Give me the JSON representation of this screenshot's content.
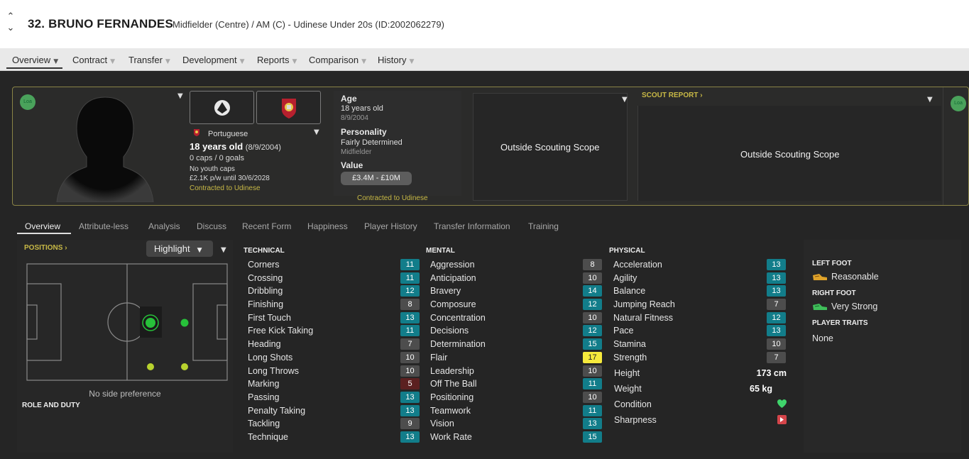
{
  "header": {
    "name": "32. BRUNO FERNANDES",
    "subtitle": "Midfielder (Centre) / AM (C) - Udinese Under 20s (ID:2002062279)"
  },
  "tabs": [
    {
      "label": "Overview",
      "active": true
    },
    {
      "label": "Contract"
    },
    {
      "label": "Transfer"
    },
    {
      "label": "Development"
    },
    {
      "label": "Reports"
    },
    {
      "label": "Comparison"
    },
    {
      "label": "History"
    }
  ],
  "profile": {
    "loan_badge": "Loa",
    "nationality": "Portuguese",
    "age_line": "18 years old",
    "dob_paren": "(8/9/2004)",
    "caps": "0 caps / 0 goals",
    "youth_caps": "No youth caps",
    "wage": "£2.1K p/w until 30/6/2028",
    "contracted": "Contracted to Udinese",
    "age_label": "Age",
    "age_value": "18 years old",
    "dob": "8/9/2004",
    "personality_label": "Personality",
    "personality_value": "Fairly Determined",
    "position_short": "Midfielder",
    "value_label": "Value",
    "value_range": "£3.4M - £10M",
    "contracted2": "Contracted to Udinese",
    "scope1": "Outside Scouting Scope",
    "scout_report": "SCOUT REPORT",
    "scope2": "Outside Scouting Scope"
  },
  "subtabs": [
    "Overview",
    "Attribute-less",
    "Analysis",
    "Discuss",
    "Recent Form",
    "Happiness",
    "Player History",
    "Transfer Information",
    "Training"
  ],
  "positions": {
    "title": "POSITIONS",
    "highlight": "Highlight",
    "no_side": "No side preference",
    "role_duty": "ROLE AND DUTY"
  },
  "technical": {
    "title": "TECHNICAL",
    "rows": [
      {
        "name": "Corners",
        "value": "11",
        "tone": "teal"
      },
      {
        "name": "Crossing",
        "value": "11",
        "tone": "teal"
      },
      {
        "name": "Dribbling",
        "value": "12",
        "tone": "teal"
      },
      {
        "name": "Finishing",
        "value": "8",
        "tone": "grey"
      },
      {
        "name": "First Touch",
        "value": "13",
        "tone": "teal"
      },
      {
        "name": "Free Kick Taking",
        "value": "11",
        "tone": "teal"
      },
      {
        "name": "Heading",
        "value": "7",
        "tone": "grey"
      },
      {
        "name": "Long Shots",
        "value": "10",
        "tone": "grey"
      },
      {
        "name": "Long Throws",
        "value": "10",
        "tone": "grey"
      },
      {
        "name": "Marking",
        "value": "5",
        "tone": "red"
      },
      {
        "name": "Passing",
        "value": "13",
        "tone": "teal"
      },
      {
        "name": "Penalty Taking",
        "value": "13",
        "tone": "teal"
      },
      {
        "name": "Tackling",
        "value": "9",
        "tone": "grey"
      },
      {
        "name": "Technique",
        "value": "13",
        "tone": "teal"
      }
    ]
  },
  "mental": {
    "title": "MENTAL",
    "rows": [
      {
        "name": "Aggression",
        "value": "8",
        "tone": "grey"
      },
      {
        "name": "Anticipation",
        "value": "10",
        "tone": "grey"
      },
      {
        "name": "Bravery",
        "value": "14",
        "tone": "teal"
      },
      {
        "name": "Composure",
        "value": "12",
        "tone": "teal"
      },
      {
        "name": "Concentration",
        "value": "10",
        "tone": "grey"
      },
      {
        "name": "Decisions",
        "value": "12",
        "tone": "teal"
      },
      {
        "name": "Determination",
        "value": "15",
        "tone": "teal"
      },
      {
        "name": "Flair",
        "value": "17",
        "tone": "yellow"
      },
      {
        "name": "Leadership",
        "value": "10",
        "tone": "grey"
      },
      {
        "name": "Off The Ball",
        "value": "11",
        "tone": "teal"
      },
      {
        "name": "Positioning",
        "value": "10",
        "tone": "grey"
      },
      {
        "name": "Teamwork",
        "value": "11",
        "tone": "teal"
      },
      {
        "name": "Vision",
        "value": "13",
        "tone": "teal"
      },
      {
        "name": "Work Rate",
        "value": "15",
        "tone": "teal"
      }
    ]
  },
  "physical": {
    "title": "PHYSICAL",
    "rows": [
      {
        "name": "Acceleration",
        "value": "13",
        "tone": "teal"
      },
      {
        "name": "Agility",
        "value": "13",
        "tone": "teal"
      },
      {
        "name": "Balance",
        "value": "13",
        "tone": "teal"
      },
      {
        "name": "Jumping Reach",
        "value": "7",
        "tone": "grey"
      },
      {
        "name": "Natural Fitness",
        "value": "12",
        "tone": "teal"
      },
      {
        "name": "Pace",
        "value": "13",
        "tone": "teal"
      },
      {
        "name": "Stamina",
        "value": "10",
        "tone": "grey"
      },
      {
        "name": "Strength",
        "value": "7",
        "tone": "grey"
      }
    ],
    "height_label": "Height",
    "height_value": "173 cm",
    "weight_label": "Weight",
    "weight_value": "65 kg",
    "condition_label": "Condition",
    "sharpness_label": "Sharpness"
  },
  "feet": {
    "left_title": "LEFT FOOT",
    "left_value": "Reasonable",
    "right_title": "RIGHT FOOT",
    "right_value": "Very Strong",
    "traits_title": "PLAYER TRAITS",
    "traits_value": "None"
  },
  "colors": {
    "teal": "#127d8a",
    "grey": "#4d4d4d",
    "red": "#5b2020",
    "yellow": "#f6ea3c",
    "gold": "#c8b946"
  }
}
